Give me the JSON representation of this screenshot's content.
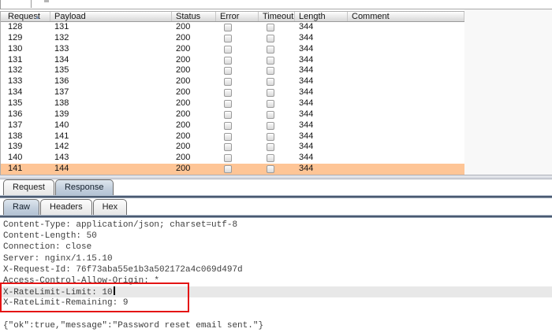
{
  "results_table": {
    "columns": [
      {
        "label": "Request",
        "sorted": true
      },
      {
        "label": "Payload"
      },
      {
        "label": "Status"
      },
      {
        "label": "Error",
        "type": "checkbox"
      },
      {
        "label": "Timeout",
        "type": "checkbox"
      },
      {
        "label": "Length"
      },
      {
        "label": "Comment"
      }
    ],
    "sort_icon": "ascending-triangle",
    "selected_row_color": "#fec596",
    "rows": [
      {
        "request": "128",
        "payload": "131",
        "status": "200",
        "error": false,
        "timeout": false,
        "length": "344",
        "comment": "",
        "selected": false
      },
      {
        "request": "129",
        "payload": "132",
        "status": "200",
        "error": false,
        "timeout": false,
        "length": "344",
        "comment": "",
        "selected": false
      },
      {
        "request": "130",
        "payload": "133",
        "status": "200",
        "error": false,
        "timeout": false,
        "length": "344",
        "comment": "",
        "selected": false
      },
      {
        "request": "131",
        "payload": "134",
        "status": "200",
        "error": false,
        "timeout": false,
        "length": "344",
        "comment": "",
        "selected": false
      },
      {
        "request": "132",
        "payload": "135",
        "status": "200",
        "error": false,
        "timeout": false,
        "length": "344",
        "comment": "",
        "selected": false
      },
      {
        "request": "133",
        "payload": "136",
        "status": "200",
        "error": false,
        "timeout": false,
        "length": "344",
        "comment": "",
        "selected": false
      },
      {
        "request": "134",
        "payload": "137",
        "status": "200",
        "error": false,
        "timeout": false,
        "length": "344",
        "comment": "",
        "selected": false
      },
      {
        "request": "135",
        "payload": "138",
        "status": "200",
        "error": false,
        "timeout": false,
        "length": "344",
        "comment": "",
        "selected": false
      },
      {
        "request": "136",
        "payload": "139",
        "status": "200",
        "error": false,
        "timeout": false,
        "length": "344",
        "comment": "",
        "selected": false
      },
      {
        "request": "137",
        "payload": "140",
        "status": "200",
        "error": false,
        "timeout": false,
        "length": "344",
        "comment": "",
        "selected": false
      },
      {
        "request": "138",
        "payload": "141",
        "status": "200",
        "error": false,
        "timeout": false,
        "length": "344",
        "comment": "",
        "selected": false
      },
      {
        "request": "139",
        "payload": "142",
        "status": "200",
        "error": false,
        "timeout": false,
        "length": "344",
        "comment": "",
        "selected": false
      },
      {
        "request": "140",
        "payload": "143",
        "status": "200",
        "error": false,
        "timeout": false,
        "length": "344",
        "comment": "",
        "selected": false
      },
      {
        "request": "141",
        "payload": "144",
        "status": "200",
        "error": false,
        "timeout": false,
        "length": "344",
        "comment": "",
        "selected": true
      }
    ]
  },
  "message_editor": {
    "tabs": [
      {
        "label": "Request",
        "selected": false
      },
      {
        "label": "Response",
        "selected": true
      }
    ],
    "view_tabs": [
      {
        "label": "Raw",
        "selected": true
      },
      {
        "label": "Headers",
        "selected": false
      },
      {
        "label": "Hex",
        "selected": false
      }
    ]
  },
  "response_view": {
    "lines": [
      "Content-Type: application/json; charset=utf-8",
      "Content-Length: 50",
      "Connection: close",
      "Server: nginx/1.15.10",
      "X-Request-Id: 76f73aba55e1b3a502172a4c069d497d",
      "Access-Control-Allow-Origin: *",
      "X-RateLimit-Limit: 10",
      "X-RateLimit-Remaining: 9",
      "",
      "{\"ok\":true,\"message\":\"Password reset email sent.\"}"
    ],
    "highlighted_line": 6,
    "caret_line": 6,
    "annotation_color": "#e41414"
  }
}
